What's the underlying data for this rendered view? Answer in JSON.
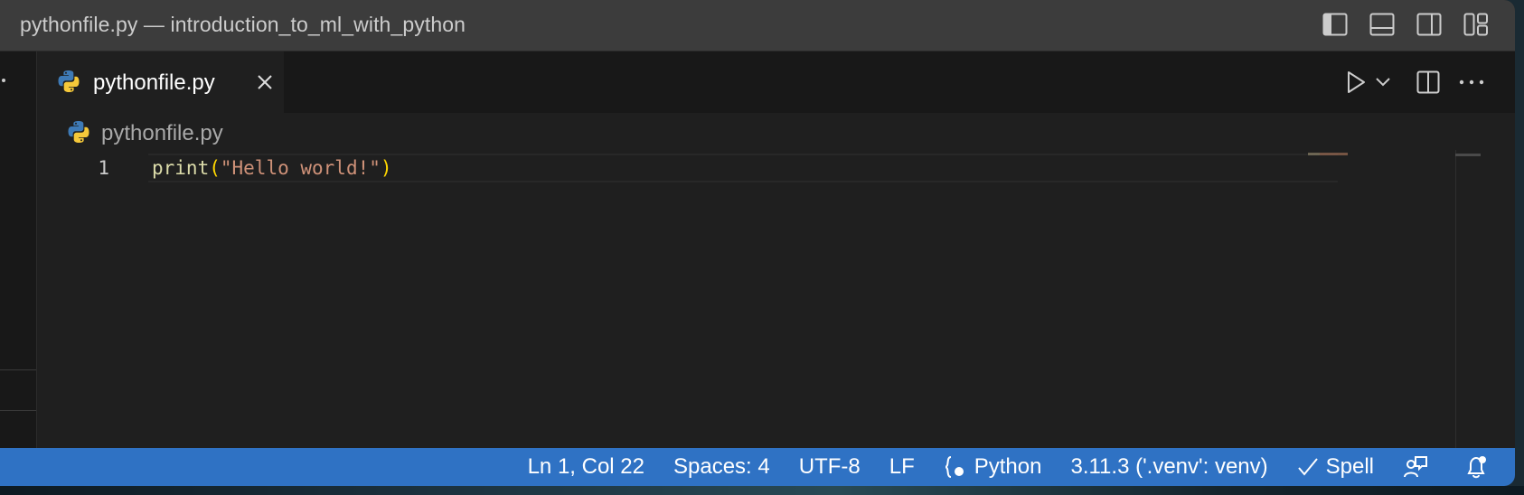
{
  "window": {
    "title": "pythonfile.py — introduction_to_ml_with_python"
  },
  "tab": {
    "label": "pythonfile.py"
  },
  "breadcrumb": {
    "label": "pythonfile.py"
  },
  "editor": {
    "line_number": "1",
    "code": {
      "fn": "print",
      "open_paren": "(",
      "string": "\"Hello world!\"",
      "close_paren": ")"
    }
  },
  "statusbar": {
    "position": "Ln 1, Col 22",
    "indentation": "Spaces: 4",
    "encoding": "UTF-8",
    "eol": "LF",
    "language": "Python",
    "interpreter": "3.11.3 ('.venv': venv)",
    "spell": "Spell"
  },
  "icons": {
    "layout": [
      "toggle-primary-sidebar-icon",
      "toggle-panel-icon",
      "toggle-secondary-sidebar-icon",
      "customize-layout-icon"
    ],
    "editor_actions": [
      "run-icon",
      "chevron-down-icon",
      "split-editor-icon",
      "more-actions-icon"
    ]
  },
  "colors": {
    "statusbar_bg": "#2f72c4",
    "editor_bg": "#1f1f1f",
    "titlebar_bg": "#3c3c3c"
  }
}
